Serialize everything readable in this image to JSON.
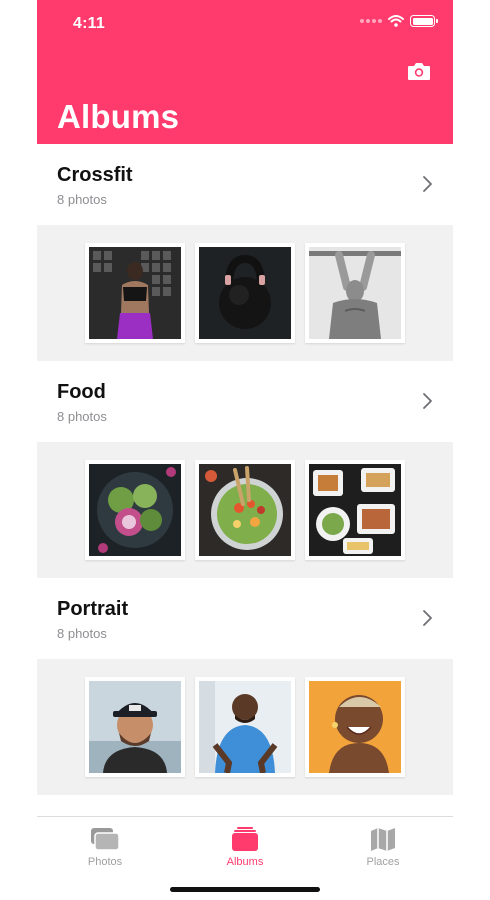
{
  "status_bar": {
    "time": "4:11"
  },
  "colors": {
    "accent": "#ff3b6e",
    "strip_bg": "#f1f1f1",
    "subtext": "#8e8e93",
    "tab_inactive": "#a0a0a0"
  },
  "header": {
    "title": "Albums",
    "camera_icon": "camera-icon"
  },
  "albums": [
    {
      "title": "Crossfit",
      "count": "8 photos",
      "thumbs": [
        "woman-gym-photo",
        "kettlebell-photo",
        "man-pullup-photo"
      ]
    },
    {
      "title": "Food",
      "count": "8 photos",
      "thumbs": [
        "cabbage-bowl-photo",
        "salad-bowl-photo",
        "dishes-table-photo"
      ]
    },
    {
      "title": "Portrait",
      "count": "8 photos",
      "thumbs": [
        "man-cap-photo",
        "man-blue-shirt-photo",
        "woman-laughing-photo"
      ]
    }
  ],
  "tabbar": {
    "tabs": [
      {
        "label": "Photos",
        "icon": "photos-icon",
        "active": false
      },
      {
        "label": "Albums",
        "icon": "albums-icon",
        "active": true
      },
      {
        "label": "Places",
        "icon": "map-icon",
        "active": false
      }
    ]
  }
}
